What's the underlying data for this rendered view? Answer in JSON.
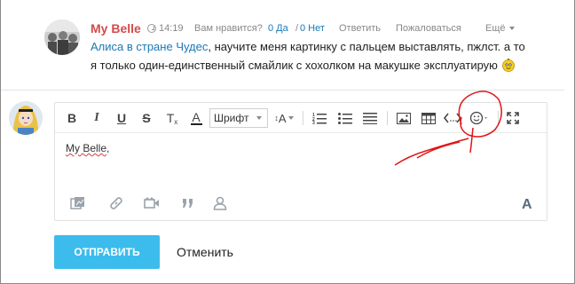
{
  "comment": {
    "author": "My Belle",
    "time": "14:19",
    "like_question": "Вам нравится?",
    "yes": "0 Да",
    "separator": "/",
    "no": "0 Нет",
    "reply": "Ответить",
    "report": "Пожаловаться",
    "more": "Ещё",
    "mention": "Алиса в стране Чудес",
    "text": ", научите меня картинку с пальцем выставлять, пжлст. а то я только один-единственный смайлик с хохолком на макушке эксплуатирую"
  },
  "toolbar": {
    "bold": "B",
    "italic": "I",
    "underline": "U",
    "strike": "S",
    "clear_format": "T",
    "font_color": "A",
    "font_select": "Шрифт",
    "font_size": "A"
  },
  "editor": {
    "content": "My Belle",
    "content_suffix": ",",
    "font_toggle": "A"
  },
  "actions": {
    "send": "ОТПРАВИТЬ",
    "cancel": "Отменить"
  },
  "colors": {
    "author": "#d24a4a",
    "link": "#1a78b5",
    "send_button": "#3cbcec",
    "annotation": "#e21515"
  },
  "icons": [
    "clock-icon",
    "chevron-down-icon",
    "smiley-icon",
    "ordered-list-icon",
    "bullet-list-icon",
    "justify-icon",
    "image-icon",
    "table-icon",
    "code-icon",
    "emoji-icon",
    "fullscreen-icon",
    "media-icon",
    "link-icon",
    "video-icon",
    "quote-icon",
    "user-icon"
  ]
}
